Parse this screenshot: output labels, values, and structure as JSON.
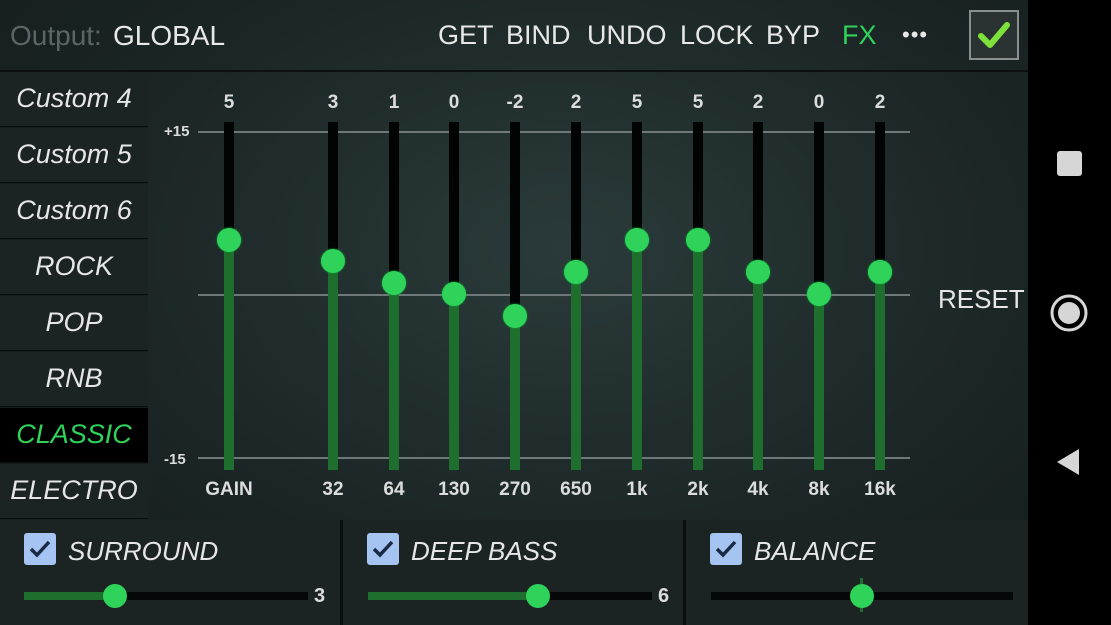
{
  "topbar": {
    "output_label": "Output:",
    "output_value": "GLOBAL",
    "buttons": [
      "GET",
      "BIND",
      "UNDO",
      "LOCK",
      "BYP",
      "FX"
    ],
    "more": "•••",
    "enabled": true
  },
  "presets": [
    {
      "label": "Custom 4",
      "active": false
    },
    {
      "label": "Custom 5",
      "active": false
    },
    {
      "label": "Custom 6",
      "active": false
    },
    {
      "label": "ROCK",
      "active": false
    },
    {
      "label": "POP",
      "active": false
    },
    {
      "label": "RNB",
      "active": false
    },
    {
      "label": "CLASSIC",
      "active": true
    },
    {
      "label": "ELECTRO",
      "active": false
    }
  ],
  "eq": {
    "scale_max": "+15",
    "scale_min": "-15",
    "range": [
      -15,
      15
    ],
    "bands": [
      {
        "label": "GAIN",
        "value": "5",
        "level": 5
      },
      {
        "label": "32",
        "value": "3",
        "level": 3
      },
      {
        "label": "64",
        "value": "1",
        "level": 1
      },
      {
        "label": "130",
        "value": "0",
        "level": 0
      },
      {
        "label": "270",
        "value": "-2",
        "level": -2
      },
      {
        "label": "650",
        "value": "2",
        "level": 2
      },
      {
        "label": "1k",
        "value": "5",
        "level": 5
      },
      {
        "label": "2k",
        "value": "5",
        "level": 5
      },
      {
        "label": "4k",
        "value": "2",
        "level": 2
      },
      {
        "label": "8k",
        "value": "0",
        "level": 0
      },
      {
        "label": "16k",
        "value": "2",
        "level": 2
      }
    ],
    "reset_label": "RESET"
  },
  "effects": {
    "surround": {
      "label": "SURROUND",
      "checked": true,
      "value": "3",
      "fraction": 0.32
    },
    "deep_bass": {
      "label": "DEEP BASS",
      "checked": true,
      "value": "6",
      "fraction": 0.6
    },
    "balance": {
      "label": "BALANCE",
      "checked": true,
      "fraction": 0.5
    }
  },
  "colors": {
    "accent": "#2fd35a",
    "fill": "#1e6e2e",
    "checkbox": "#a6c4f2"
  },
  "nav": {
    "icons": [
      "recents-icon",
      "home-icon",
      "back-icon"
    ]
  }
}
